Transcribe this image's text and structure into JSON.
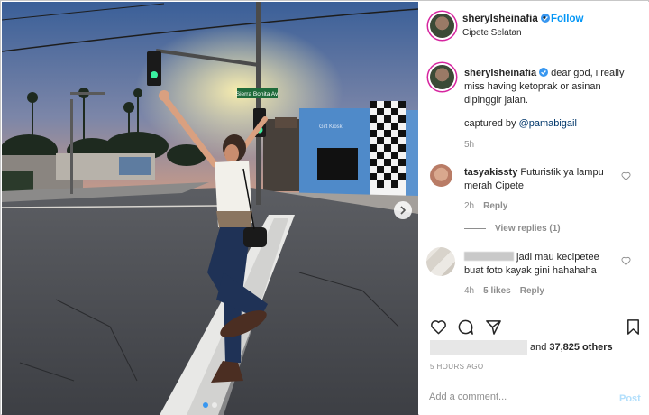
{
  "colors": {
    "accent": "#0095f6",
    "verified": "#3897f0",
    "muted": "#8e8e8e",
    "post_disabled": "#b2dffc",
    "sky_top": "#3a5f98",
    "sunset": "#f8b868"
  },
  "photo": {
    "street_sign": "Sierra Bonita Av",
    "carousel_total": 2,
    "carousel_index": 1,
    "next_icon": "chevron-right-icon"
  },
  "header": {
    "username": "sherylsheinafia",
    "verified_icon": "verified-badge-icon",
    "separator": "•",
    "follow_label": "Follow",
    "location": "Cipete Selatan"
  },
  "caption": {
    "username": "sherylsheinafia",
    "text": "dear god, i really miss having ketoprak or asinan dipinggir jalan.",
    "credit_prefix": "captured by ",
    "credit_mention": "@pamabigail",
    "time": "5h"
  },
  "comments": [
    {
      "username": "tasyakissty",
      "text": "Futuristik ya lampu merah Cipete",
      "time": "2h",
      "reply_label": "Reply",
      "view_replies": "View replies (1)"
    },
    {
      "text": "jadi mau kecipetee buat foto kayak gini hahahaha",
      "time": "4h",
      "likes": "5 likes",
      "reply_label": "Reply"
    }
  ],
  "actions": {
    "like_icon": "heart-icon",
    "comment_icon": "comment-icon",
    "share_icon": "paper-plane-icon",
    "save_icon": "bookmark-icon"
  },
  "likes": {
    "prefix": "and",
    "count": "37,825 others"
  },
  "post_time": "5 HOURS AGO",
  "add_comment": {
    "placeholder": "Add a comment...",
    "post_label": "Post"
  }
}
